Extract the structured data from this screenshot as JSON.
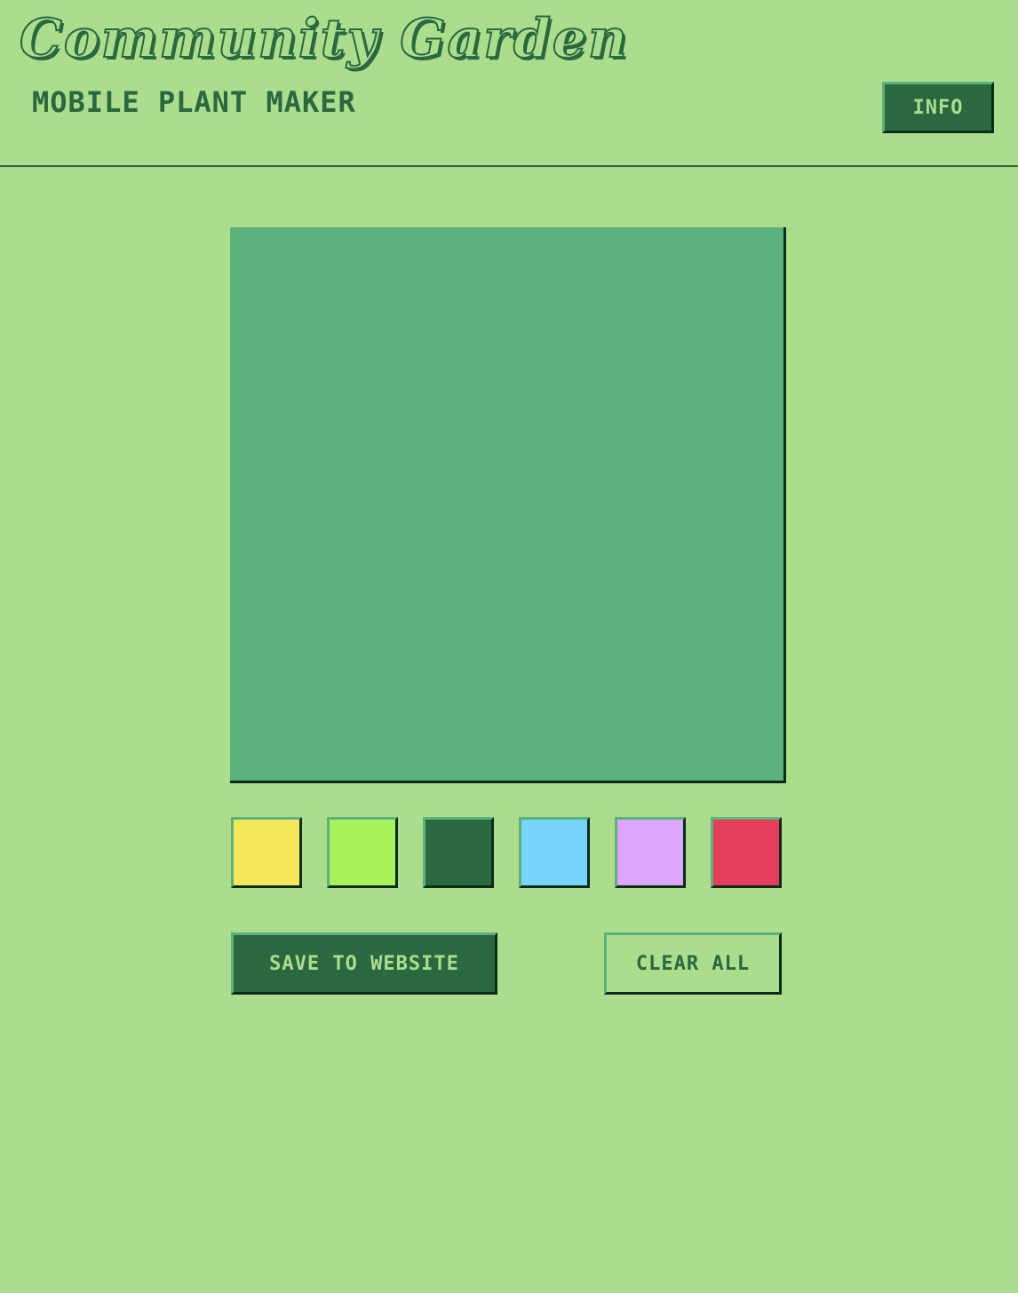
{
  "header": {
    "title": "Community Garden",
    "subtitle": "MOBILE PLANT MAKER",
    "info_label": "INFO"
  },
  "canvas": {
    "background_color": "#5cb27c"
  },
  "palette": {
    "colors": [
      {
        "name": "yellow",
        "hex": "#f4e85a"
      },
      {
        "name": "lime",
        "hex": "#a8f25e"
      },
      {
        "name": "dark-green",
        "hex": "#2a6840"
      },
      {
        "name": "light-blue",
        "hex": "#76d4fa"
      },
      {
        "name": "lavender",
        "hex": "#dea6fa"
      },
      {
        "name": "red",
        "hex": "#e43e5c"
      }
    ]
  },
  "actions": {
    "save_label": "SAVE TO WEBSITE",
    "clear_label": "CLEAR ALL"
  },
  "theme": {
    "background": "#abdd8d",
    "primary": "#2a6840",
    "accent": "#5cb27c",
    "shadow": "#0e2a18"
  }
}
